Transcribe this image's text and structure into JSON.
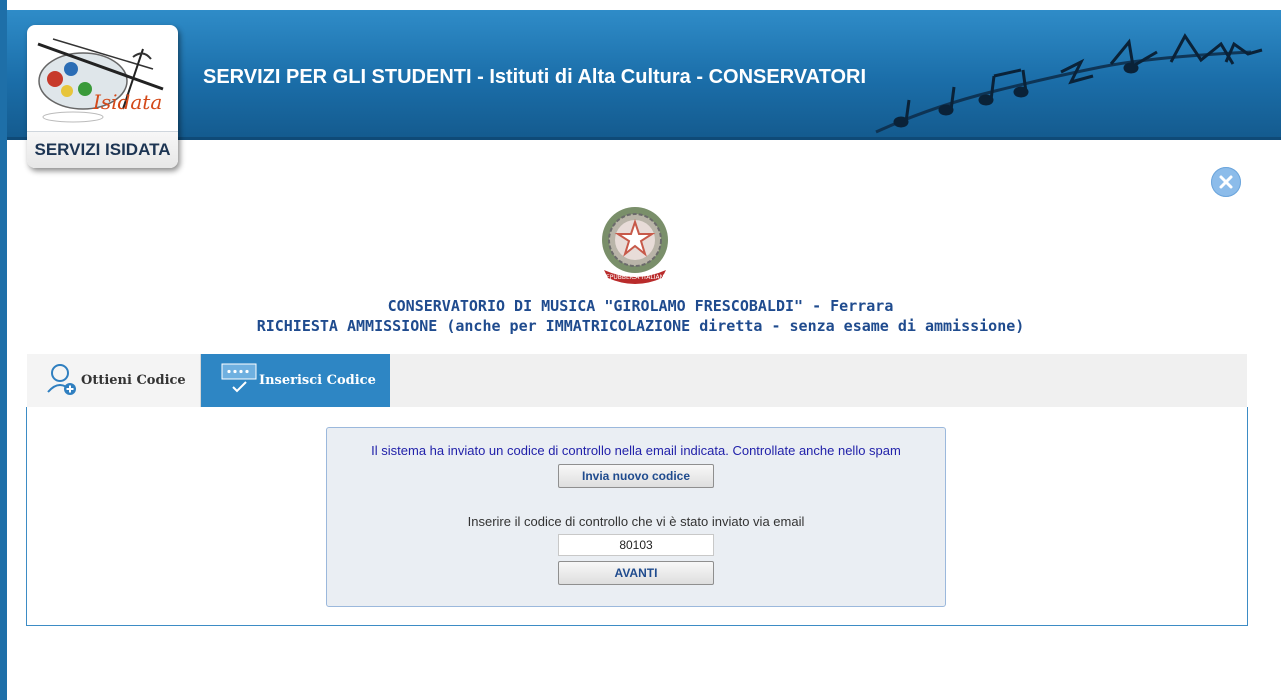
{
  "header": {
    "title": "SERVIZI PER GLI STUDENTI - Istituti di Alta Cultura - CONSERVATORI",
    "logo_label": "SERVIZI ISIDATA",
    "logo_brand": "Isidata"
  },
  "institution": {
    "line1": "CONSERVATORIO DI MUSICA \"GIROLAMO FRESCOBALDI\" - Ferrara",
    "line2": "RICHIESTA AMMISSIONE (anche per IMMATRICOLAZIONE diretta - senza esame di ammissione)",
    "emblem_text": "REPUBBLICA ITALIANA"
  },
  "tabs": [
    {
      "label": "Ottieni Codice",
      "icon": "user-add-icon",
      "active": false
    },
    {
      "label": "Inserisci Codice",
      "icon": "code-check-icon",
      "active": true
    }
  ],
  "panel": {
    "message": "Il sistema ha inviato un codice di controllo nella email indicata. Controllate anche nello spam",
    "resend_label": "Invia nuovo codice",
    "prompt": "Inserire il codice di controllo che vi è stato inviato via email",
    "code_value": "80103",
    "next_label": "AVANTI"
  },
  "colors": {
    "header_blue": "#1b6ea9",
    "tab_active": "#2e86c4",
    "institution_text": "#1f4b8e",
    "message_text": "#2222aa"
  }
}
